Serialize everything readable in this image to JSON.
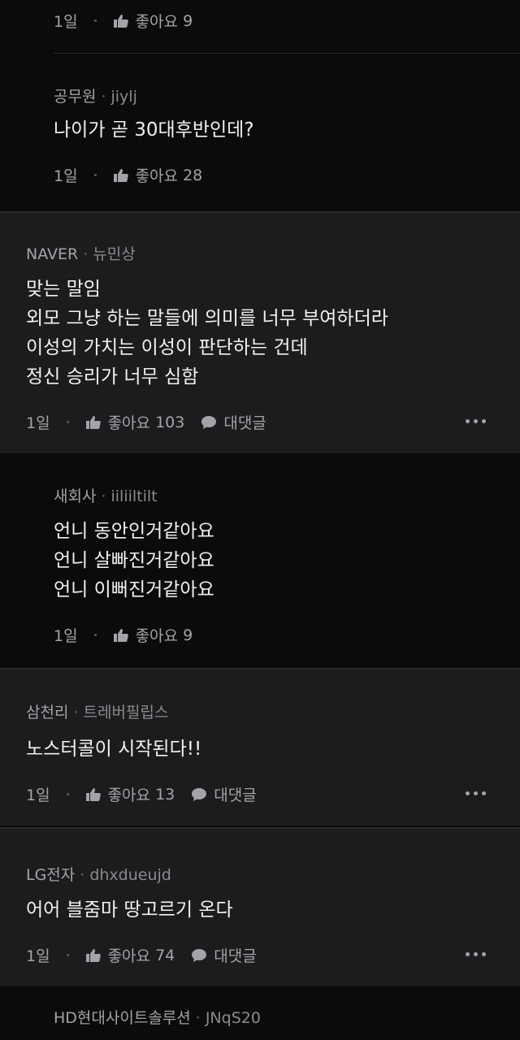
{
  "comments": [
    {
      "id": "reply-1",
      "time": "1일",
      "like_label": "좋아요",
      "like_count": "9"
    },
    {
      "id": "reply-2",
      "company": "공무원",
      "user": "jiylj",
      "lines": [
        "나이가 곧 30대후반인데?"
      ],
      "time": "1일",
      "like_label": "좋아요",
      "like_count": "28"
    },
    {
      "id": "comment-3",
      "company": "NAVER",
      "user": "뉴민상",
      "lines": [
        "맞는 말임",
        "외모 그냥 하는 말들에 의미를 너무 부여하더라",
        "이성의 가치는 이성이 판단하는 건데",
        "정신 승리가 너무 심함"
      ],
      "time": "1일",
      "like_label": "좋아요",
      "like_count": "103",
      "reply_label": "대댓글"
    },
    {
      "id": "reply-4",
      "company": "새회사",
      "user": "iiliiltilt",
      "lines": [
        "언니 동안인거같아요",
        "언니 살빠진거같아요",
        "언니 이뻐진거같아요"
      ],
      "time": "1일",
      "like_label": "좋아요",
      "like_count": "9"
    },
    {
      "id": "comment-5",
      "company": "삼천리",
      "user": "트레버필립스",
      "lines": [
        "노스터콜이 시작된다!!"
      ],
      "time": "1일",
      "like_label": "좋아요",
      "like_count": "13",
      "reply_label": "대댓글"
    },
    {
      "id": "comment-6",
      "company": "LG전자",
      "user": "dhxdueujd",
      "lines": [
        "어어 블줌마 땅고르기 온다"
      ],
      "time": "1일",
      "like_label": "좋아요",
      "like_count": "74",
      "reply_label": "대댓글"
    },
    {
      "id": "reply-7",
      "company": "HD현대사이트솔루션",
      "user": "JNqS20"
    }
  ],
  "icons": {
    "like": "thumbs-up-icon",
    "reply": "speech-bubble-icon",
    "more": "more-dots-icon"
  },
  "colors": {
    "background": "#0b0b0c",
    "top_comment_bg": "#1c1c1e",
    "text": "#f1f1f2",
    "meta": "#a4a4a8"
  }
}
